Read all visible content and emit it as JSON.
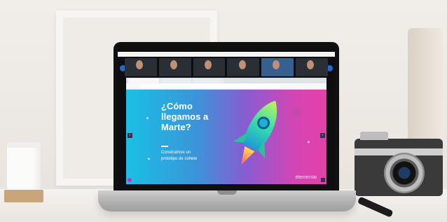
{
  "slide": {
    "title_lines": [
      "¿Cómo",
      "llegamos a",
      "Marte?"
    ],
    "subtitle_lines": [
      "Construimos un",
      "prototipo de cohete"
    ],
    "brand": "élementai"
  },
  "browser": {
    "tabs": [
      "",
      "",
      ""
    ],
    "address": ""
  },
  "participants": [
    "",
    "",
    "",
    "",
    "",
    ""
  ],
  "colors": {
    "slide_cyan": "#19c0e6",
    "slide_pink": "#e440a8",
    "meet_blue": "#1e6ad2"
  }
}
